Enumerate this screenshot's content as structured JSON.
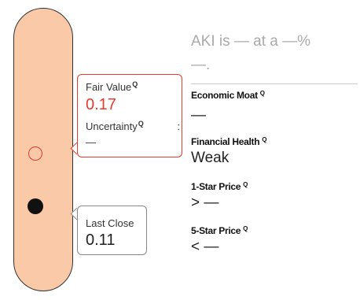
{
  "gauge": {
    "fair_value": {
      "label": "Fair Value",
      "value": "0.17",
      "uncertainty_label": "Uncertainty",
      "uncertainty_sep": ":",
      "uncertainty_value": "—",
      "info_icon": "Q"
    },
    "last_close": {
      "label": "Last Close",
      "value": "0.11"
    },
    "colors": {
      "capsule": "#f9c9a8",
      "fair_value_accent": "#e23b2f"
    }
  },
  "headline": {
    "line1": "AKI is — at a —%",
    "line2": "—."
  },
  "metrics": [
    {
      "title": "Economic Moat",
      "info_icon": "Q",
      "value": "—"
    },
    {
      "title": "Financial Health",
      "info_icon": "Q",
      "value": "Weak"
    },
    {
      "title": "1-Star Price",
      "info_icon": "Q",
      "value": "> —"
    },
    {
      "title": "5-Star Price",
      "info_icon": "Q",
      "value": "< —"
    }
  ]
}
